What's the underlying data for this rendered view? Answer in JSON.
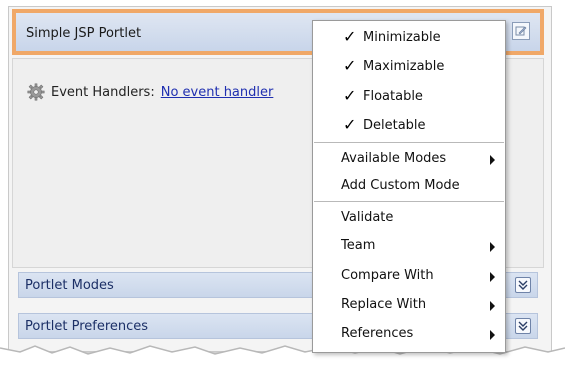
{
  "portlet": {
    "title": "Simple JSP Portlet",
    "event_label": "Event Handlers:",
    "event_link": "No event handler"
  },
  "sections": {
    "modes": "Portlet Modes",
    "preferences": "Portlet Preferences"
  },
  "menu": {
    "checked_items": [
      "Minimizable",
      "Maximizable",
      "Floatable",
      "Deletable"
    ],
    "check_glyph": "✓",
    "mode_items": [
      "Available Modes",
      "Add Custom Mode"
    ],
    "action_items": [
      "Validate",
      "Team",
      "Compare With",
      "Replace With",
      "References"
    ]
  },
  "icons": {
    "edit": "edit-icon",
    "gear": "gear-icon",
    "expand": "chevron-double-down-icon",
    "submenu": "submenu-arrow-icon"
  },
  "colors": {
    "header_highlight": "#f0a868",
    "section_bar": "#c9d6ea",
    "link": "#1f2fb0"
  }
}
